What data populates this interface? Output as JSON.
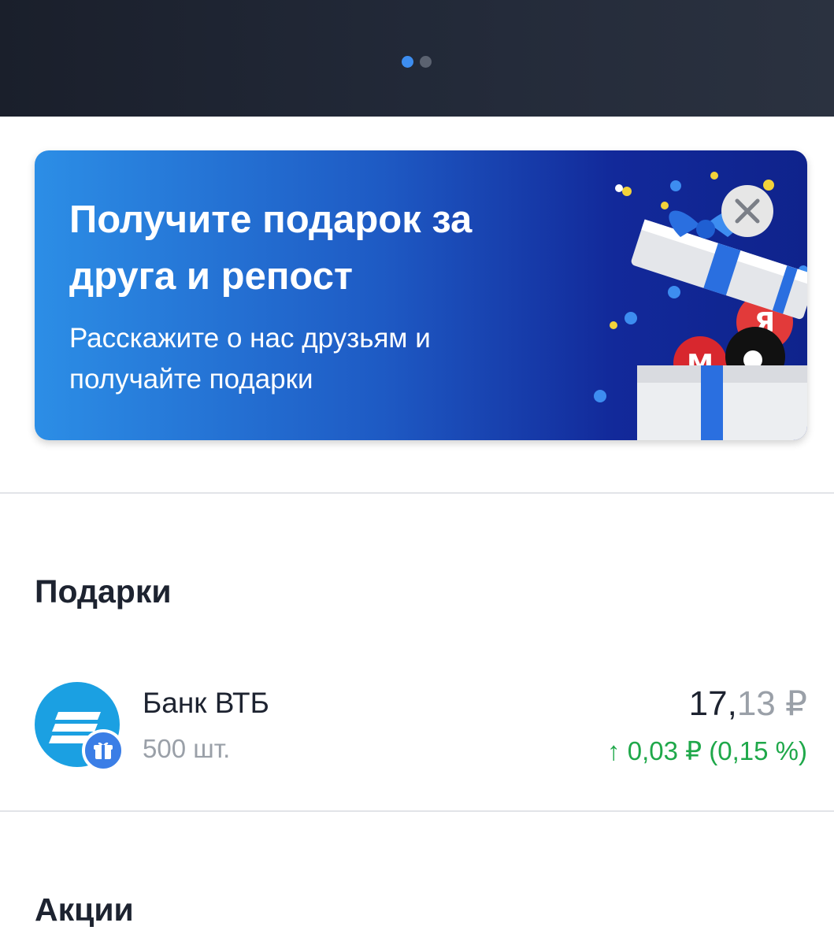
{
  "pager": {
    "count": 2,
    "active_index": 0
  },
  "promo": {
    "title": "Получите подарок за друга и репост",
    "subtitle": "Расскажите о нас друзьям и получайте подарки",
    "close_icon": "close-icon",
    "colors": {
      "gradient_start": "#2c8ee6",
      "gradient_end": "#0f238c"
    }
  },
  "gifts": {
    "heading": "Подарки",
    "items": [
      {
        "name": "Банк ВТБ",
        "quantity": "500 шт.",
        "price_int": "17,",
        "price_frac": "13 ₽",
        "change_arrow": "↑",
        "change": "0,03 ₽ (0,15 %)",
        "icon": "vtb-logo-icon",
        "badge_icon": "gift-icon"
      }
    ]
  },
  "stocks": {
    "heading": "Акции"
  },
  "colors": {
    "positive": "#1fa84a",
    "accent": "#3d8df0",
    "brand_vtb": "#1ba0e2"
  }
}
